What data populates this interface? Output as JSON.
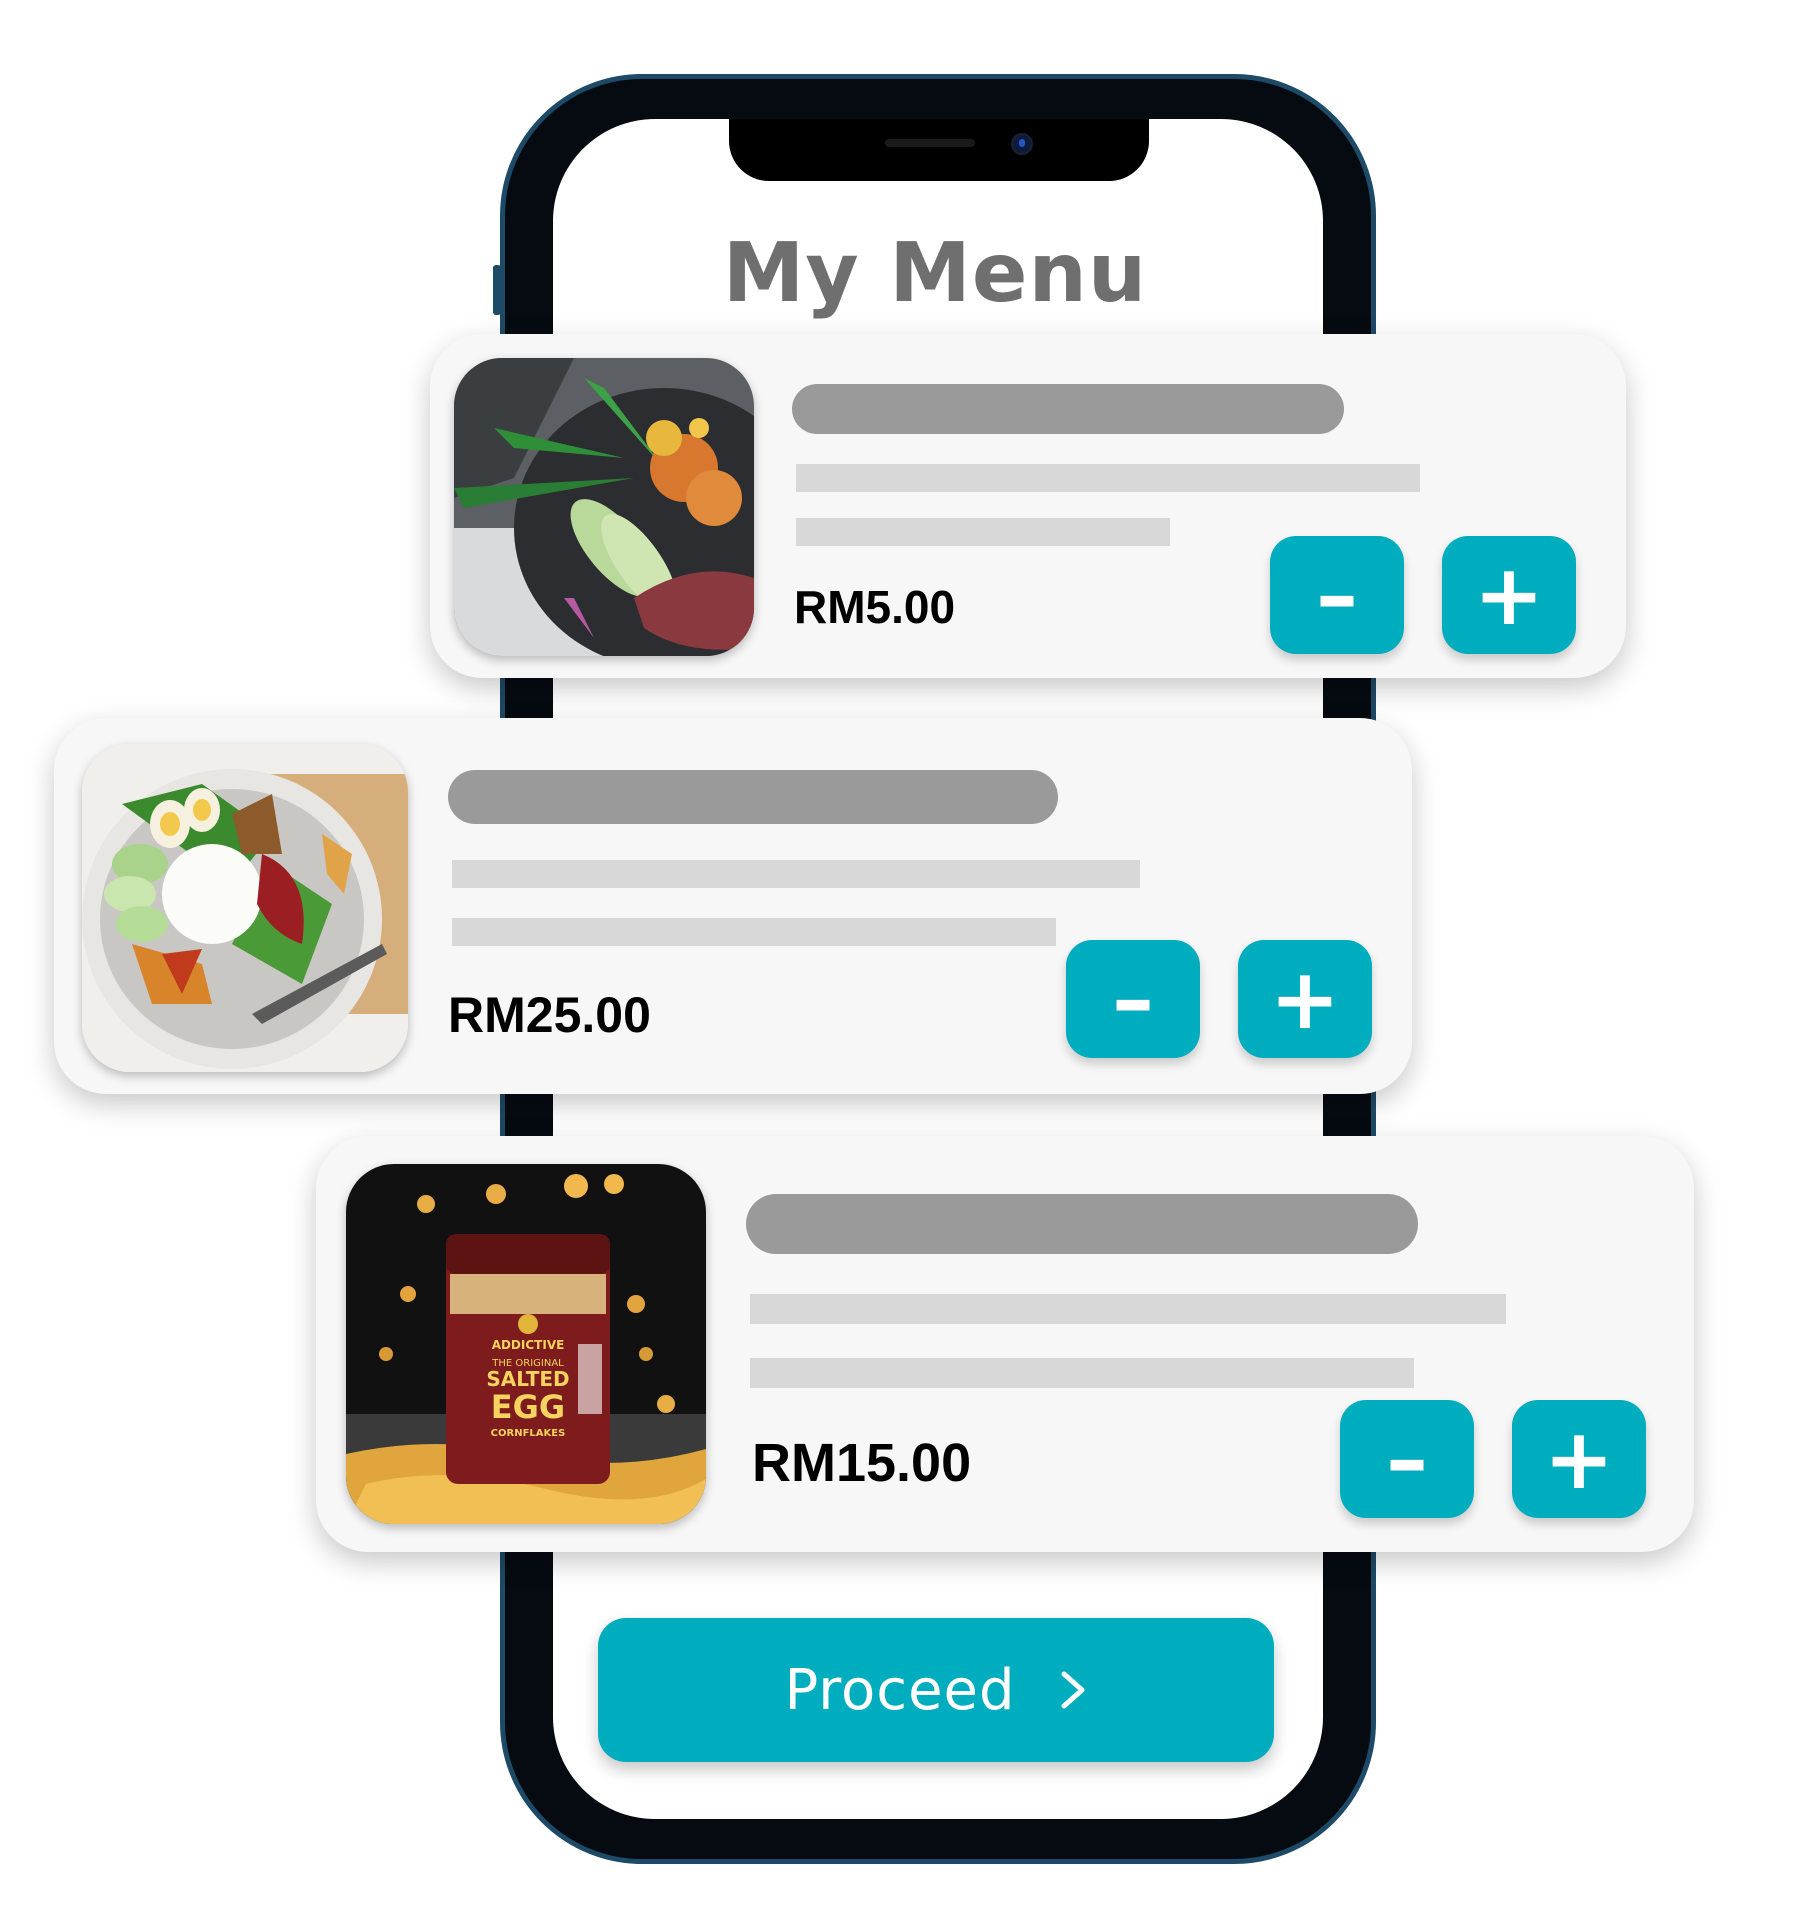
{
  "screen": {
    "title": "My Menu"
  },
  "menu_items": [
    {
      "image": "poke-bowl-photo",
      "price": "RM5.00",
      "decrement_label": "–",
      "increment_label": "+"
    },
    {
      "image": "nasi-lemak-photo",
      "price": "RM25.00",
      "decrement_label": "–",
      "increment_label": "+"
    },
    {
      "image": "salted-egg-cornflakes-jar-photo",
      "price": "RM15.00",
      "decrement_label": "–",
      "increment_label": "+"
    }
  ],
  "product_label": {
    "brand": "ADDICTIVE",
    "line1": "THE ORIGINAL",
    "line2": "SALTED",
    "line3": "EGG",
    "line4": "CORNFLAKES"
  },
  "proceed_button": {
    "label": "Proceed",
    "icon": "chevron-right-icon"
  },
  "colors": {
    "accent": "#00adbe",
    "card_bg": "#f7f7f7",
    "title_text": "#6f6f6f",
    "placeholder_dark": "#9a9a9a",
    "placeholder_light": "#d8d8d8",
    "phone_frame": "#1d4a66"
  }
}
